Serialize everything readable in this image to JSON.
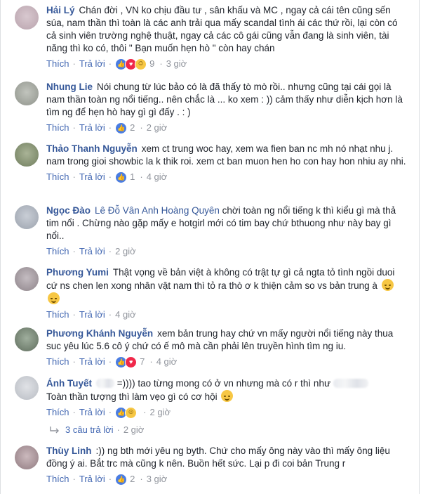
{
  "actions": {
    "like": "Thích",
    "reply": "Trả lời"
  },
  "comments": [
    {
      "author": "Hải Lý",
      "tag": "",
      "text": "Chán đời , VN ko chịu đầu tư , sân khấu và MC , ngay cả cái tên cũng sến súa, nam thần thì toàn là các anh trải qua mấy scandal tình ái các thứ rồi, lại còn có cả sinh viên trường nghệ thuật, ngay cả các cô gái cũng vẫn đang là sinh viên, tài năng thì ko có, thôi \" Bạn muốn hẹn hò \" còn hay chán",
      "reactions": [
        "like",
        "love",
        "haha"
      ],
      "count": "9",
      "time": "3 giờ",
      "avatar_color": "#c9b7bf"
    },
    {
      "author": "Nhung Lie",
      "tag": "",
      "text": "Nói chung từ lúc bảo có là đã thấy tò mò rồi.. nhưng cũng tại cái gọi là nam thần toàn ng nổi tiếng.. nên chắc là ... ko xem : )) cảm thấy như diễn kịch hơn là tìm ng để hẹn hò hay gì gì đấy . : )",
      "reactions": [
        "like"
      ],
      "count": "2",
      "time": "2 giờ",
      "avatar_color": "#aeb2ab"
    },
    {
      "author": "Thảo Thanh Nguyễn",
      "tag": "",
      "text": "xem ct trung woc hay, xem wa fien ban nc mh nó nhạt nhu j. nam trong gioi showbic la k thik roi. xem ct ban muon hen ho con hay hon nhiu ay nhi.",
      "reactions": [
        "like"
      ],
      "count": "1",
      "time": "4 giờ",
      "avatar_color": "#8e9a7e"
    },
    {
      "author": "Ngọc Đào",
      "tag": "Lê Đỗ Vân Anh Hoàng Quyên",
      "text": "chời toàn ng nổi tiếng k thì kiểu gì mà thả tim nổi . Chừng nào gặp mấy e hotgirl mới có tim bay chứ bthuong như này bay gì nổi..",
      "reactions": [],
      "count": "",
      "time": "2 giờ",
      "avatar_color": "#b3b9c4"
    },
    {
      "author": "Phương Yumi",
      "tag": "",
      "text": "Thật vọng về bản việt à không có trật tự gì cả ngta tỏ tình ngồi duoi cứ ns chen len xong nhân vật nam thì tỏ ra thò ơ k thiện cảm so vs bản trung à",
      "reactions": [],
      "count": "",
      "time": "4 giờ",
      "avatar_color": "#a99fa6"
    },
    {
      "author": "Phương Khánh Nguyễn",
      "tag": "",
      "text": "xem bản trung hay chứ vn mấy người nổi tiếng này thua suc yêu lúc 5.6 cô ý chứ có ế mô mà cần phải lên truyền hình tìm ng iu.",
      "reactions": [
        "like",
        "love"
      ],
      "count": "7",
      "time": "4 giờ",
      "avatar_color": "#7e8f7f"
    },
    {
      "author": "Ánh Tuyết",
      "tag": "",
      "text": "=)))) tao từng mong có ở vn nhưng mà có r thì như",
      "text2": "Toàn thần tượng thì làm vẹo gì có cơ hội",
      "reactions": [
        "like",
        "haha"
      ],
      "count": "",
      "time": "2 giờ",
      "avatar_color": "#cfd1d6"
    },
    {
      "author": "Thùy Linh",
      "tag": "",
      "text": ":)) ng bth mới yêu ng byth. Chứ cho mấy ông này vào thì mấy ông liệu đồng ý ai. Bắt trc mà cũng k nên. Buồn hết sức. Lại p đi coi bản Trung r",
      "reactions": [
        "like"
      ],
      "count": "2",
      "time": "3 giờ",
      "avatar_color": "#b59fa4"
    }
  ],
  "replies_summary": {
    "label": "3 câu trả lời",
    "time": "2 giờ"
  }
}
